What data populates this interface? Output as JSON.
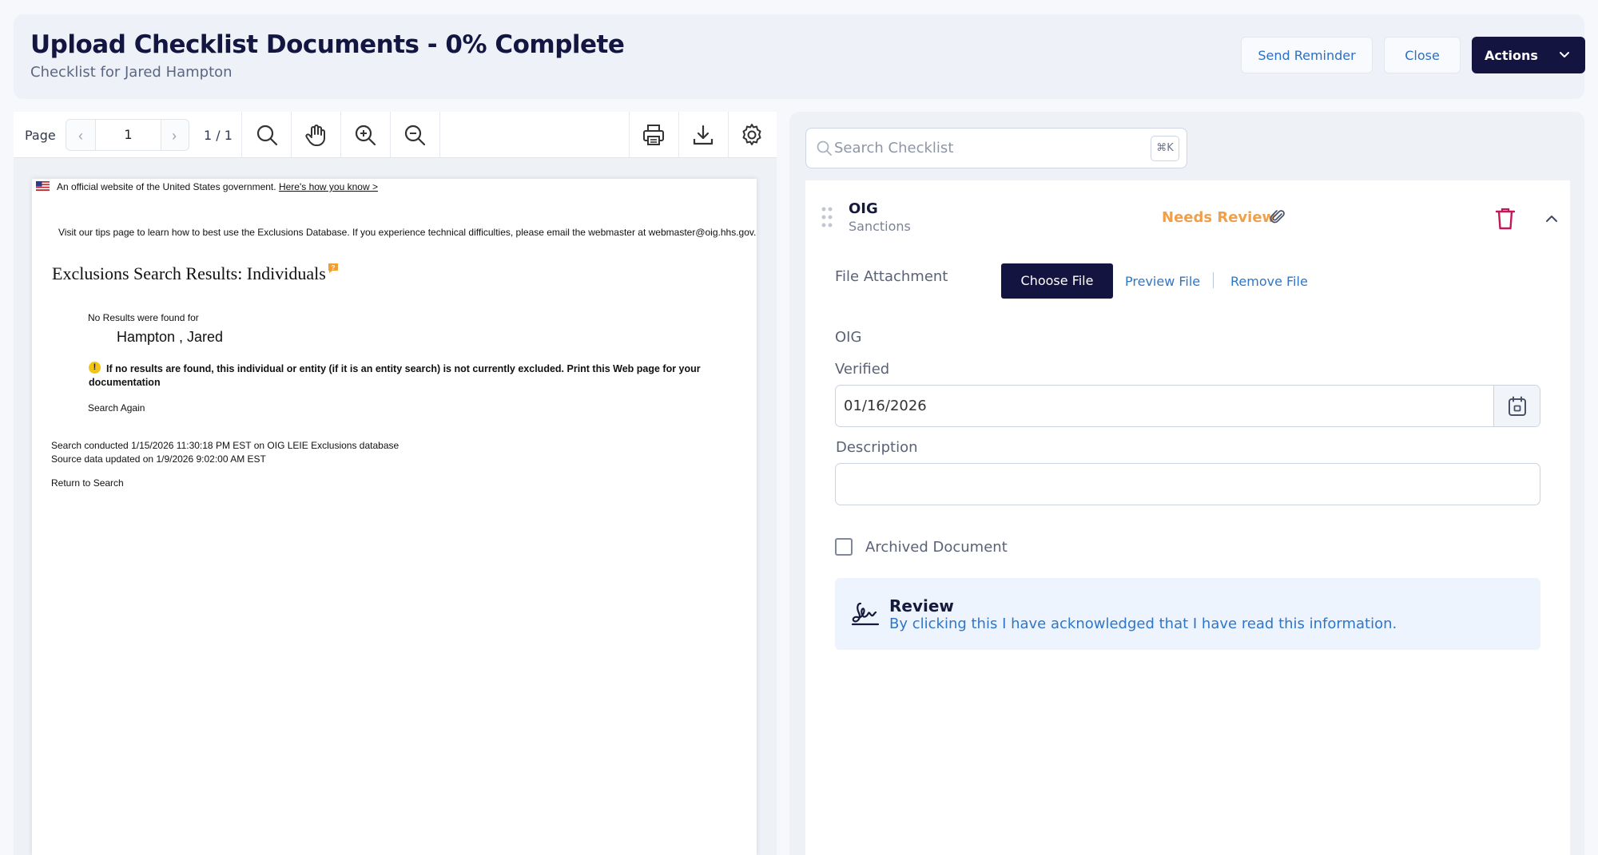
{
  "header": {
    "title": "Upload Checklist Documents - 0% Complete",
    "subtitle": "Checklist for Jared Hampton",
    "send_reminder": "Send Reminder",
    "close": "Close",
    "actions": "Actions"
  },
  "viewer": {
    "page_label": "Page",
    "page_value": "1",
    "page_count": "1 / 1",
    "icons": [
      "search-icon",
      "pan-hand-icon",
      "zoom-in-icon",
      "zoom-out-icon",
      "print-icon",
      "download-icon",
      "gear-icon"
    ]
  },
  "document": {
    "official_text": "An official website of the United States government.",
    "official_link": "Here's how you know >",
    "tips": "Visit our tips page to learn how to best use the Exclusions Database. If you experience technical difficulties, please email the webmaster at webmaster@oig.hhs.gov.",
    "heading": "Exclusions Search Results: Individuals",
    "no_results": "No Results were found for",
    "name": "Hampton , Jared",
    "warning_icon": "!",
    "warning": "If no results are found, this individual or entity (if it is an entity search) is not currently excluded. Print this Web page for your documentation",
    "search_again": "Search Again",
    "conducted": "Search conducted 1/15/2026 11:30:18 PM EST on OIG LEIE Exclusions database",
    "source": "Source data updated on 1/9/2026 9:02:00 AM EST",
    "return": "Return to Search"
  },
  "panel": {
    "search_placeholder": "Search Checklist",
    "shortcut": "⌘K",
    "item": {
      "title": "OIG",
      "subtitle": "Sanctions",
      "status": "Needs Review",
      "status_color": "#f0a04b",
      "file_attachment_label": "File Attachment",
      "choose_file": "Choose File",
      "preview_file": "Preview File",
      "remove_file": "Remove File",
      "oig_label": "OIG",
      "verified_label": "Verified",
      "verified_value": "01/16/2026",
      "description_label": "Description",
      "description_value": "",
      "archived_label": "Archived Document",
      "archived_checked": false,
      "review_title": "Review",
      "review_desc": "By clicking this I have acknowledged that I have read this information."
    }
  },
  "colors": {
    "primary_dark": "#131540",
    "link_blue": "#2f76c9",
    "trash_magenta": "#c2185b"
  }
}
